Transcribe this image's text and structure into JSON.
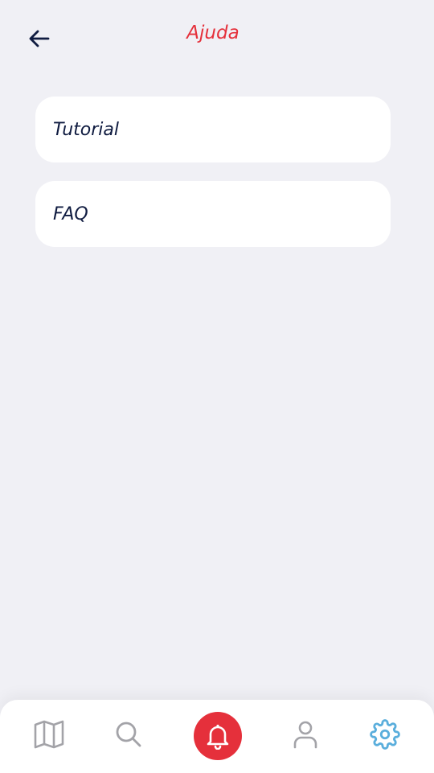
{
  "header": {
    "title": "Ajuda",
    "back_icon": "arrow-left-icon"
  },
  "menu": {
    "items": [
      {
        "label": "Tutorial"
      },
      {
        "label": "FAQ"
      }
    ]
  },
  "tabbar": {
    "tabs": [
      {
        "icon": "map-icon",
        "active": false
      },
      {
        "icon": "search-icon",
        "active": false
      },
      {
        "icon": "bell-icon",
        "active": false,
        "highlighted": true
      },
      {
        "icon": "user-icon",
        "active": false
      },
      {
        "icon": "gear-icon",
        "active": true
      }
    ]
  },
  "colors": {
    "accent": "#e5303b",
    "text_primary": "#0f1b40",
    "background": "#f0f0f5",
    "icon_inactive": "#a3a3a8",
    "icon_active": "#5aaedc"
  }
}
